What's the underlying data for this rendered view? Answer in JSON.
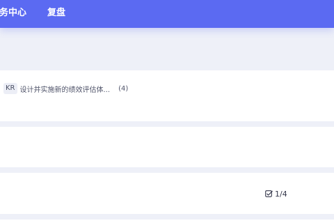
{
  "nav": {
    "items": [
      {
        "label": "务中心"
      },
      {
        "label": "复盘"
      }
    ]
  },
  "cards": [
    {
      "kr_badge": "KR",
      "title": "设计并实施新的绩效评估体...",
      "count": "(4)"
    },
    {},
    {
      "progress_icon": "checkbox-check-icon",
      "progress": "1/4"
    }
  ],
  "colors": {
    "header": "#5b6af2",
    "page_background": "#eef0f8",
    "card": "#ffffff"
  }
}
